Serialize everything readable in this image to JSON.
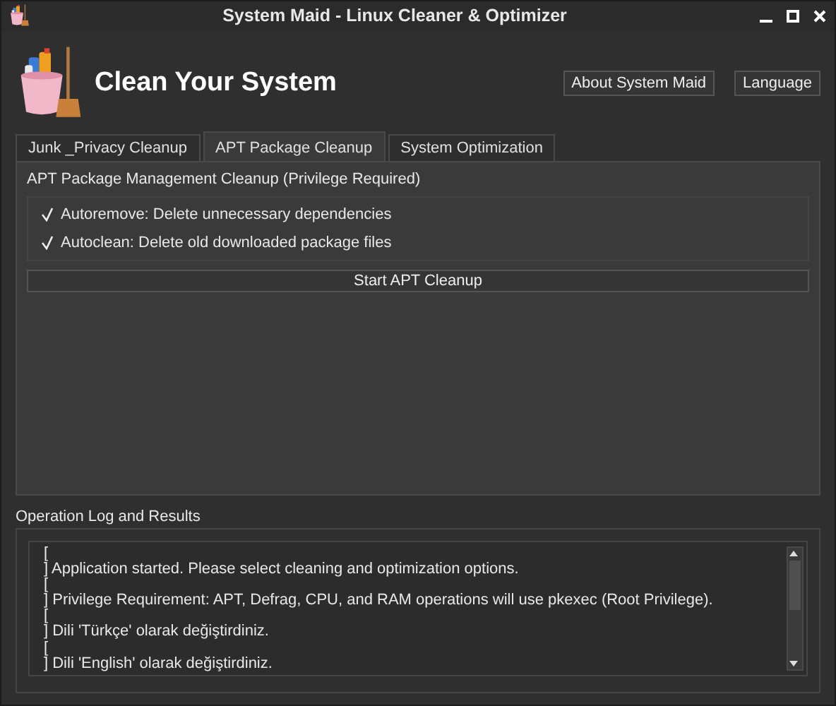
{
  "window": {
    "title": "System Maid - Linux Cleaner & Optimizer"
  },
  "header": {
    "title": "Clean Your System",
    "buttons": [
      "About System Maid",
      "Language"
    ]
  },
  "tabs": [
    {
      "label": "Junk _Privacy Cleanup",
      "selected": false
    },
    {
      "label": "APT Package Cleanup",
      "selected": true
    },
    {
      "label": "System Optimization",
      "selected": false
    }
  ],
  "panel": {
    "heading": "APT Package Management Cleanup (Privilege Required)",
    "options": [
      {
        "label": "Autoremove: Delete unnecessary dependencies",
        "checked": true
      },
      {
        "label": "Autoclean: Delete old downloaded package files",
        "checked": true
      }
    ],
    "action_button": "Start APT Cleanup"
  },
  "log": {
    "title": "Operation Log and Results",
    "lines": [
      "[",
      "] Application started. Please select cleaning and optimization options.",
      "[",
      "] Privilege Requirement: APT, Defrag, CPU, and RAM operations will use pkexec (Root Privilege).",
      "[",
      "] Dili 'Türkçe' olarak değiştirdiniz.",
      "[",
      "] Dili 'English' olarak değiştirdiniz."
    ]
  }
}
